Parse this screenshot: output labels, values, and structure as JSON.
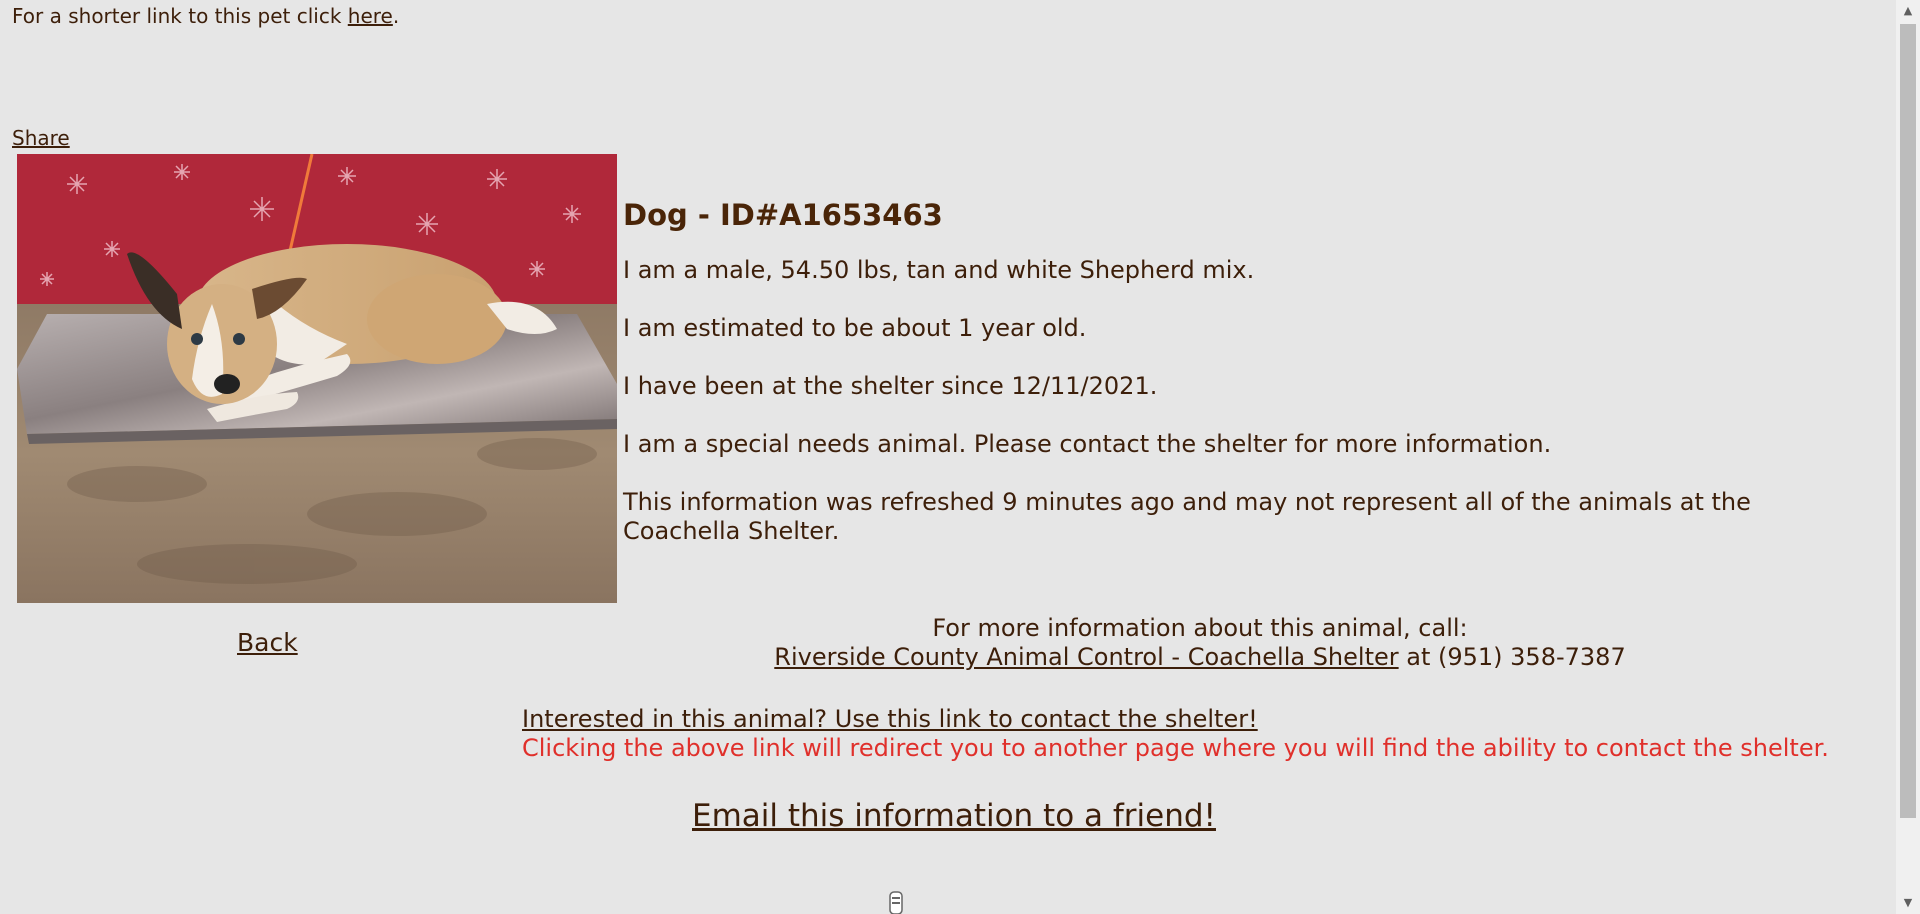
{
  "short_link": {
    "prefix": "For a shorter link to this pet click ",
    "link_text": "here",
    "suffix": "."
  },
  "share_label": "Share",
  "photo": {
    "alt": "Tan and white Shepherd mix dog lying on a metal scale"
  },
  "animal": {
    "title": "Dog - ID#A1653463",
    "description": "I am a male, 54.50 lbs, tan and white Shepherd mix.",
    "age": "I am estimated to be about 1 year old.",
    "since": "I have been at the shelter since 12/11/2021.",
    "special_needs": "I am a special needs animal. Please contact the shelter for more information.",
    "refresh_note": "This information was refreshed 9 minutes ago and may not represent all of the animals at the Coachella Shelter."
  },
  "back_label": "Back",
  "more_info": {
    "line1": "For more information about this animal, call:",
    "shelter_name": "Riverside County Animal Control - Coachella Shelter",
    "at_text": " at (951) 358-7387"
  },
  "contact": {
    "link_text": "Interested in this animal? Use this link to contact the shelter!",
    "note": "Clicking the above link will redirect you to another page where you will find the ability to contact the shelter."
  },
  "email_label": "Email this information to a friend!",
  "colors": {
    "background": "#e6e6e6",
    "text": "#3d1f0a",
    "note_red": "#e0302b"
  }
}
